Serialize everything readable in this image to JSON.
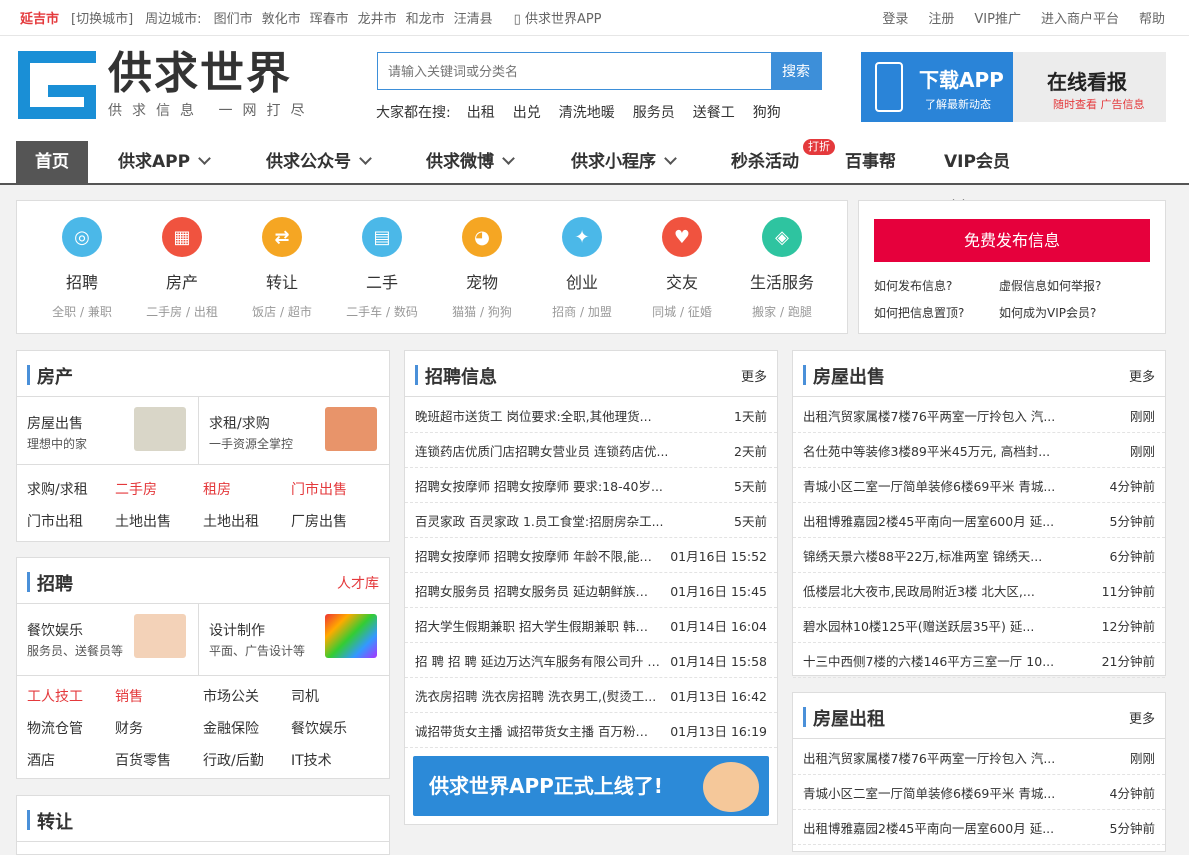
{
  "topbar": {
    "city": "延吉市",
    "switch": "[切换城市]",
    "nearby_label": "周边城市:",
    "nearby": [
      "图们市",
      "敦化市",
      "珲春市",
      "龙井市",
      "和龙市",
      "汪清县"
    ],
    "app_link": "供求世界APP",
    "right": [
      "登录",
      "注册",
      "VIP推广",
      "进入商户平台",
      "帮助"
    ]
  },
  "logo": {
    "name": "供求世界",
    "slogan": "供求信息 一网打尽"
  },
  "search": {
    "placeholder": "请输入关键词或分类名",
    "button": "搜索"
  },
  "hot": {
    "label": "大家都在搜:",
    "items": [
      "出租",
      "出兑",
      "清洗地暖",
      "服务员",
      "送餐工",
      "狗狗"
    ]
  },
  "banner": {
    "dl_title": "下载APP",
    "dl_sub": "了解最新动态",
    "watch_title": "在线看报",
    "watch_sub": "随时查看 广告信息"
  },
  "nav": {
    "items": [
      "首页",
      "供求APP",
      "供求公众号",
      "供求微博",
      "供求小程序",
      "秒杀活动",
      "百事帮",
      "VIP会员"
    ],
    "tag": "打折"
  },
  "categories": [
    {
      "name": "招聘",
      "sub": "全职 / 兼职",
      "color": "#4bb8e8",
      "icon": "search-person-icon",
      "glyph": "◎"
    },
    {
      "name": "房产",
      "sub": "二手房 / 出租",
      "color": "#f0533f",
      "icon": "building-icon",
      "glyph": "▦"
    },
    {
      "name": "转让",
      "sub": "饭店 / 超市",
      "color": "#f5a623",
      "icon": "transfer-icon",
      "glyph": "⇄"
    },
    {
      "name": "二手",
      "sub": "二手车 / 数码",
      "color": "#4bb8e8",
      "icon": "calendar-icon",
      "glyph": "▤"
    },
    {
      "name": "宠物",
      "sub": "猫猫 / 狗狗",
      "color": "#f5a623",
      "icon": "cat-icon",
      "glyph": "◕"
    },
    {
      "name": "创业",
      "sub": "招商 / 加盟",
      "color": "#4bb8e8",
      "icon": "handshake-icon",
      "glyph": "✦"
    },
    {
      "name": "交友",
      "sub": "同城 / 征婚",
      "color": "#f0533f",
      "icon": "heart-icon",
      "glyph": "♥"
    },
    {
      "name": "生活服务",
      "sub": "搬家 / 跑腿",
      "color": "#2ec4a0",
      "icon": "compass-icon",
      "glyph": "◈"
    }
  ],
  "publish": {
    "button": "免费发布信息",
    "faq": [
      "如何发布信息?",
      "虚假信息如何举报?",
      "如何把信息置顶?",
      "如何成为VIP会员?"
    ]
  },
  "house": {
    "title": "房产",
    "features": [
      {
        "name": "房屋出售",
        "sub": "理想中的家"
      },
      {
        "name": "求租/求购",
        "sub": "一手资源全掌控"
      }
    ],
    "links": [
      {
        "t": "求购/求租",
        "red": false
      },
      {
        "t": "二手房",
        "red": true
      },
      {
        "t": "租房",
        "red": true
      },
      {
        "t": "门市出售",
        "red": true
      },
      {
        "t": "门市出租",
        "red": false
      },
      {
        "t": "土地出售",
        "red": false
      },
      {
        "t": "土地出租",
        "red": false
      },
      {
        "t": "厂房出售",
        "red": false
      }
    ]
  },
  "jobs": {
    "title": "招聘",
    "more": "人才库",
    "features": [
      {
        "name": "餐饮娱乐",
        "sub": "服务员、送餐员等"
      },
      {
        "name": "设计制作",
        "sub": "平面、广告设计等"
      }
    ],
    "links": [
      {
        "t": "工人技工",
        "red": true
      },
      {
        "t": "销售",
        "red": true
      },
      {
        "t": "市场公关",
        "red": false
      },
      {
        "t": "司机",
        "red": false
      },
      {
        "t": "物流仓管",
        "red": false
      },
      {
        "t": "财务",
        "red": false
      },
      {
        "t": "金融保险",
        "red": false
      },
      {
        "t": "餐饮娱乐",
        "red": false
      },
      {
        "t": "酒店",
        "red": false
      },
      {
        "t": "百货零售",
        "red": false
      },
      {
        "t": "行政/后勤",
        "red": false
      },
      {
        "t": "IT技术",
        "red": false
      }
    ]
  },
  "transfer": {
    "title": "转让"
  },
  "recruit": {
    "title": "招聘信息",
    "more": "更多",
    "rows": [
      {
        "t": "晚班超市送货工 岗位要求:全职,其他理货...",
        "tm": "1天前"
      },
      {
        "t": "连锁药店优质门店招聘女营业员 连锁药店优...",
        "tm": "2天前"
      },
      {
        "t": "招聘女按摩师 招聘女按摩师 要求:18-40岁...",
        "tm": "5天前"
      },
      {
        "t": "百灵家政 百灵家政 1.员工食堂:招厨房杂工...",
        "tm": "5天前"
      },
      {
        "t": "招聘女按摩师 招聘女按摩师 年龄不限,能长...",
        "tm": "01月16日 15:52"
      },
      {
        "t": "招聘女服务员 招聘女服务员 延边朝鲜族民俗...",
        "tm": "01月16日 15:45"
      },
      {
        "t": "招大学生假期兼职 招大学生假期兼职 韩服写...",
        "tm": "01月14日 16:04"
      },
      {
        "t": "招 聘 招 聘 延边万达汽车服务有限公司升 诚...",
        "tm": "01月14日 15:58"
      },
      {
        "t": "洗衣房招聘 洗衣房招聘 洗衣男工,(熨烫工...",
        "tm": "01月13日 16:42"
      },
      {
        "t": "诚招带货女主播 诚招带货女主播 百万粉丝带...",
        "tm": "01月13日 16:19"
      }
    ],
    "promo": "供求世界APP正式上线了!"
  },
  "sale": {
    "title": "房屋出售",
    "more": "更多",
    "rows": [
      {
        "t": "出租汽贸家属楼7楼76平两室一厅拎包入 汽...",
        "tm": "刚刚"
      },
      {
        "t": "名仕苑中等装修3楼89平米45万元, 高档封...",
        "tm": "刚刚"
      },
      {
        "t": "青城小区二室一厅简单装修6楼69平米 青城...",
        "tm": "4分钟前"
      },
      {
        "t": "出租博雅嘉园2楼45平南向一居室600月 延...",
        "tm": "5分钟前"
      },
      {
        "t": "锦绣天景六楼88平22万,标准两室 锦绣天...",
        "tm": "6分钟前"
      },
      {
        "t": "低楼层北大夜市,民政局附近3楼 北大区,...",
        "tm": "11分钟前"
      },
      {
        "t": "碧水园林10楼125平(赠送跃层35平) 延...",
        "tm": "12分钟前"
      },
      {
        "t": "十三中西侧7楼的六楼146平方三室一厅 10...",
        "tm": "21分钟前"
      }
    ]
  },
  "rent": {
    "title": "房屋出租",
    "more": "更多",
    "rows": [
      {
        "t": "出租汽贸家属楼7楼76平两室一厅拎包入 汽...",
        "tm": "刚刚"
      },
      {
        "t": "青城小区二室一厅简单装修6楼69平米 青城...",
        "tm": "4分钟前"
      },
      {
        "t": "出租博雅嘉园2楼45平南向一居室600月 延...",
        "tm": "5分钟前"
      }
    ]
  }
}
